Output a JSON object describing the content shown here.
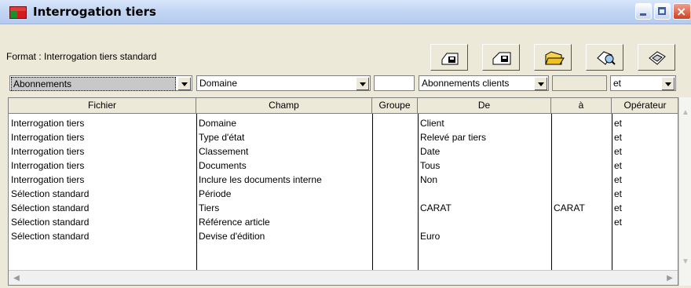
{
  "window": {
    "title": "Interrogation tiers"
  },
  "format": {
    "label": "Format : Interrogation tiers standard"
  },
  "toolbar": {
    "icons": [
      "save-icon",
      "save-as-icon",
      "open-folder-icon",
      "search-icon",
      "execute-icon"
    ]
  },
  "filters": {
    "file": "Abonnements",
    "field": "Domaine",
    "group": "",
    "from": "Abonnements clients",
    "to": "",
    "operator": "et"
  },
  "grid": {
    "columns": [
      "Fichier",
      "Champ",
      "Groupe",
      "De",
      "à",
      "Opérateur"
    ],
    "rows": [
      [
        "Interrogation tiers",
        "Domaine",
        "",
        "Client",
        "",
        "et"
      ],
      [
        "Interrogation tiers",
        "Type d'état",
        "",
        "Relevé par tiers",
        "",
        "et"
      ],
      [
        "Interrogation tiers",
        "Classement",
        "",
        "Date",
        "",
        "et"
      ],
      [
        "Interrogation tiers",
        "Documents",
        "",
        "Tous",
        "",
        "et"
      ],
      [
        "Interrogation tiers",
        "Inclure les documents interne",
        "",
        "Non",
        "",
        "et"
      ],
      [
        "Sélection standard",
        "Période",
        "",
        "",
        "",
        "et"
      ],
      [
        "Sélection standard",
        "Tiers",
        "",
        "CARAT",
        "CARAT",
        "et"
      ],
      [
        "Sélection standard",
        "Référence article",
        "",
        "",
        "",
        "et"
      ],
      [
        "Sélection standard",
        "Devise d'édition",
        "",
        "Euro",
        "",
        ""
      ]
    ]
  }
}
